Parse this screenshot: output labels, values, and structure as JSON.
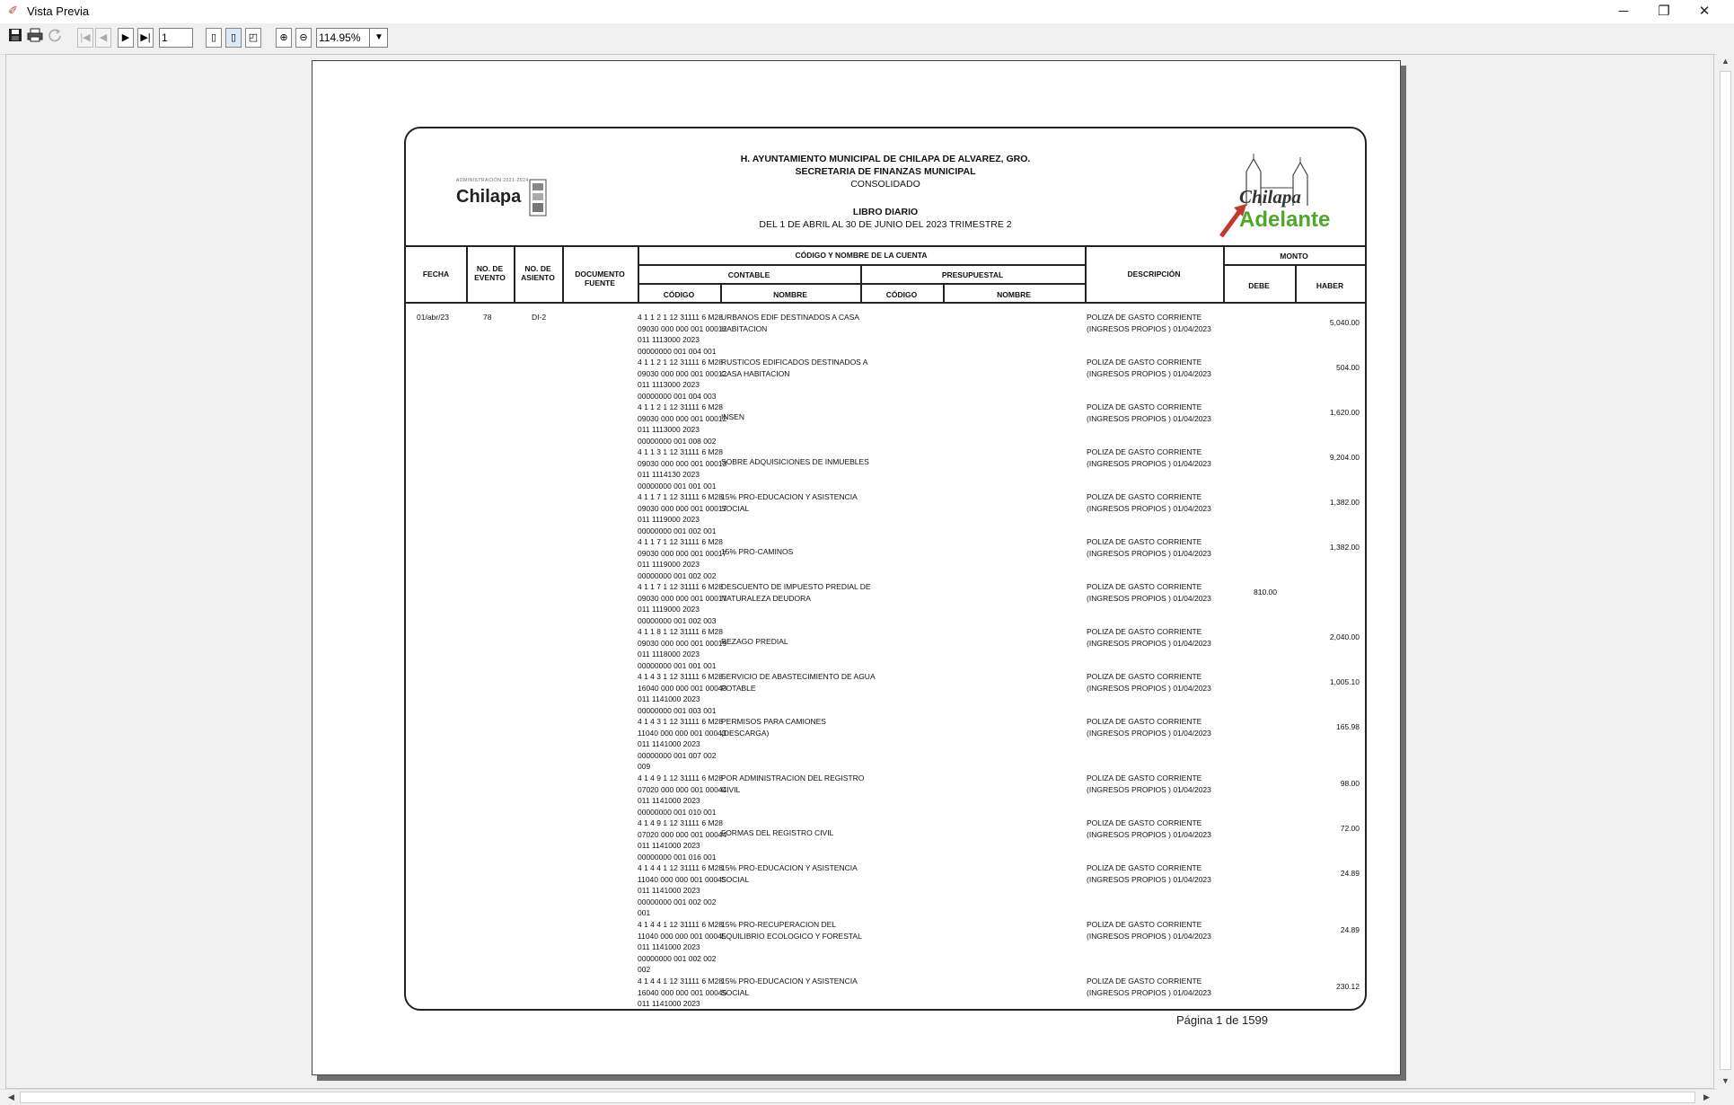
{
  "window": {
    "title": "Vista Previa",
    "minimize": "─",
    "restore": "❐",
    "close": "✕"
  },
  "toolbar": {
    "save_icon": "save-icon",
    "print_icon": "print-icon",
    "refresh_icon": "refresh-icon",
    "first_page": "|◀",
    "prev_page": "◀",
    "next_page": "▶",
    "last_page": "▶|",
    "page_value": "1",
    "single_page": "▯",
    "page_width": "▯",
    "multi_page": "◰",
    "zoom_in": "⊕",
    "zoom_out": "⊖",
    "zoom_value": "114.95%",
    "zoom_arrow": "▼"
  },
  "report": {
    "org": "H. AYUNTAMIENTO MUNICIPAL DE CHILAPA DE ALVAREZ, GRO.",
    "dept": "SECRETARIA DE FINANZAS MUNICIPAL",
    "consolidated": "CONSOLIDADO",
    "report_title": "LIBRO DIARIO",
    "period": "DEL 1 DE ABRIL AL 30 DE JUNIO DEL 2023 TRIMESTRE 2",
    "logo_left_small": "ADMINISTRACIÓN 2021-2024",
    "logo_left_word": "Chilapa",
    "logo_right_word1": "Chilapa",
    "logo_right_word2": "Adelante",
    "headers": {
      "fecha": "FECHA",
      "evento": "NO. DE EVENTO",
      "asiento": "NO. DE ASIENTO",
      "doc": "DOCUMENTO FUENTE",
      "cuenta": "CÓDIGO Y NOMBRE DE LA CUENTA",
      "contable": "CONTABLE",
      "presupuestal": "PRESUPUESTAL",
      "codigo": "CÓDIGO",
      "nombre": "NOMBRE",
      "codigo2": "CÓDIGO",
      "nombre2": "NOMBRE",
      "descripcion": "DESCRIPCIÓN",
      "monto": "MONTO",
      "debe": "DEBE",
      "haber": "HABER"
    },
    "first_row": {
      "fecha": "01/abr/23",
      "evento": "78",
      "asiento": "DI-2"
    },
    "rows": [
      {
        "code": [
          "4 1 1 2 1 12 31111 6 M28",
          "09030 000 000 001 00012",
          "011 1113000 2023",
          "00000000 001 004 001"
        ],
        "name": [
          "URBANOS EDIF DESTINADOS A CASA",
          "HABITACION"
        ],
        "desc": [
          "POLIZA DE GASTO CORRIENTE",
          "(INGRESOS PROPIOS ) 01/04/2023"
        ],
        "debe": "",
        "haber": "5,040.00"
      },
      {
        "code": [
          "4 1 1 2 1 12 31111 6 M28",
          "09030 000 000 001 00012",
          "011 1113000 2023",
          "00000000 001 004 003"
        ],
        "name": [
          "RUSTICOS EDIFICADOS DESTINADOS A",
          "CASA HABITACION"
        ],
        "desc": [
          "POLIZA DE GASTO CORRIENTE",
          "(INGRESOS PROPIOS ) 01/04/2023"
        ],
        "debe": "",
        "haber": "504.00"
      },
      {
        "code": [
          "4 1 1 2 1 12 31111 6 M28",
          "09030 000 000 001 00012",
          "011 1113000 2023",
          "00000000 001 008 002"
        ],
        "name": [
          "INSEN"
        ],
        "desc": [
          "POLIZA DE GASTO CORRIENTE",
          "(INGRESOS PROPIOS ) 01/04/2023"
        ],
        "debe": "",
        "haber": "1,620.00"
      },
      {
        "code": [
          "4 1 1 3 1 12 31111 6 M28",
          "09030 000 000 001 00013",
          "011 1114130 2023",
          "00000000 001 001 001"
        ],
        "name": [
          "SOBRE ADQUISICIONES DE INMUEBLES"
        ],
        "desc": [
          "POLIZA DE GASTO CORRIENTE",
          "(INGRESOS PROPIOS ) 01/04/2023"
        ],
        "debe": "",
        "haber": "9,204.00"
      },
      {
        "code": [
          "4 1 1 7 1 12 31111 6 M28",
          "09030 000 000 001 00017",
          "011 1119000 2023",
          "00000000 001 002 001"
        ],
        "name": [
          "15%  PRO-EDUCACION Y ASISTENCIA",
          "SOCIAL"
        ],
        "desc": [
          "POLIZA DE GASTO CORRIENTE",
          "(INGRESOS PROPIOS ) 01/04/2023"
        ],
        "debe": "",
        "haber": "1,382.00"
      },
      {
        "code": [
          "4 1 1 7 1 12 31111 6 M28",
          "09030 000 000 001 00017",
          "011 1119000 2023",
          "00000000 001 002 002"
        ],
        "name": [
          "15%  PRO-CAMINOS"
        ],
        "desc": [
          "POLIZA DE GASTO CORRIENTE",
          "(INGRESOS PROPIOS ) 01/04/2023"
        ],
        "debe": "",
        "haber": "1,382.00"
      },
      {
        "code": [
          "4 1 1 7 1 12 31111 6 M28",
          "09030 000 000 001 00017",
          "011 1119000 2023",
          "00000000 001 002 003"
        ],
        "name": [
          "DESCUENTO DE IMPUESTO PREDIAL DE",
          "NATURALEZA DEUDORA"
        ],
        "desc": [
          "POLIZA DE GASTO CORRIENTE",
          "(INGRESOS PROPIOS ) 01/04/2023"
        ],
        "debe": "810.00",
        "haber": ""
      },
      {
        "code": [
          "4 1 1 8 1 12 31111 6 M28",
          "09030 000 000 001 00019",
          "011 1118000 2023",
          "00000000 001 001 001"
        ],
        "name": [
          "REZAGO PREDIAL"
        ],
        "desc": [
          "POLIZA DE GASTO CORRIENTE",
          "(INGRESOS PROPIOS ) 01/04/2023"
        ],
        "debe": "",
        "haber": "2,040.00"
      },
      {
        "code": [
          "4 1 4 3 1 12 31111 6 M28",
          "16040 000 000 001 00043",
          "011 1141000 2023",
          "00000000 001 003 001"
        ],
        "name": [
          "SERVICIO DE ABASTECIMIENTO DE AGUA",
          "POTABLE"
        ],
        "desc": [
          "POLIZA DE GASTO CORRIENTE",
          "(INGRESOS PROPIOS ) 01/04/2023"
        ],
        "debe": "",
        "haber": "1,005.10"
      },
      {
        "code": [
          "4 1 4 3 1 12 31111 6 M28",
          "11040 000 000 001 00043",
          "011 1141000 2023",
          "00000000 001 007 002",
          "009"
        ],
        "name": [
          "PERMISOS PARA CAMIONES",
          "(DESCARGA)"
        ],
        "desc": [
          "POLIZA DE GASTO CORRIENTE",
          "(INGRESOS PROPIOS ) 01/04/2023"
        ],
        "debe": "",
        "haber": "165.98"
      },
      {
        "code": [
          "4 1 4 9 1 12 31111 6 M28",
          "07020 000 000 001 00044",
          "011 1141000 2023",
          "00000000 001 010 001"
        ],
        "name": [
          "POR ADMINISTRACION DEL REGISTRO",
          "CIVIL"
        ],
        "desc": [
          "POLIZA DE GASTO CORRIENTE",
          "(INGRESOS PROPIOS ) 01/04/2023"
        ],
        "debe": "",
        "haber": "98.00"
      },
      {
        "code": [
          "4 1 4 9 1 12 31111 6 M28",
          "07020 000 000 001 00044",
          "011 1141000 2023",
          "00000000 001 016 001"
        ],
        "name": [
          "FORMAS DEL REGISTRO CIVIL"
        ],
        "desc": [
          "POLIZA DE GASTO CORRIENTE",
          "(INGRESOS PROPIOS ) 01/04/2023"
        ],
        "debe": "",
        "haber": "72.00"
      },
      {
        "code": [
          "4 1 4 4 1 12 31111 6 M28",
          "11040 000 000 001 00045",
          "011 1141000 2023",
          "00000000 001 002 002",
          "001"
        ],
        "name": [
          "15% PRO-EDUCACION Y ASISTENCIA",
          "SOCIAL"
        ],
        "desc": [
          "POLIZA DE GASTO CORRIENTE",
          "(INGRESOS PROPIOS ) 01/04/2023"
        ],
        "debe": "",
        "haber": "24.89"
      },
      {
        "code": [
          "4 1 4 4 1 12 31111 6 M28",
          "11040 000 000 001 00045",
          "011 1141000 2023",
          "00000000 001 002 002",
          "002"
        ],
        "name": [
          "15% PRO-RECUPERACION DEL",
          "EQUILIBRIO ECOLOGICO Y FORESTAL"
        ],
        "desc": [
          "POLIZA DE GASTO CORRIENTE",
          "(INGRESOS PROPIOS ) 01/04/2023"
        ],
        "debe": "",
        "haber": "24.89"
      },
      {
        "code": [
          "4 1 4 4 1 12 31111 6 M28",
          "16040 000 000 001 00045",
          "011 1141000 2023"
        ],
        "name": [
          "15% PRO-EDUCACION Y ASISTENCIA",
          "SOCIAL"
        ],
        "desc": [
          "POLIZA DE GASTO CORRIENTE",
          "(INGRESOS PROPIOS ) 01/04/2023"
        ],
        "debe": "",
        "haber": "230.12"
      }
    ],
    "page_label": "Página 1 de 1599"
  }
}
